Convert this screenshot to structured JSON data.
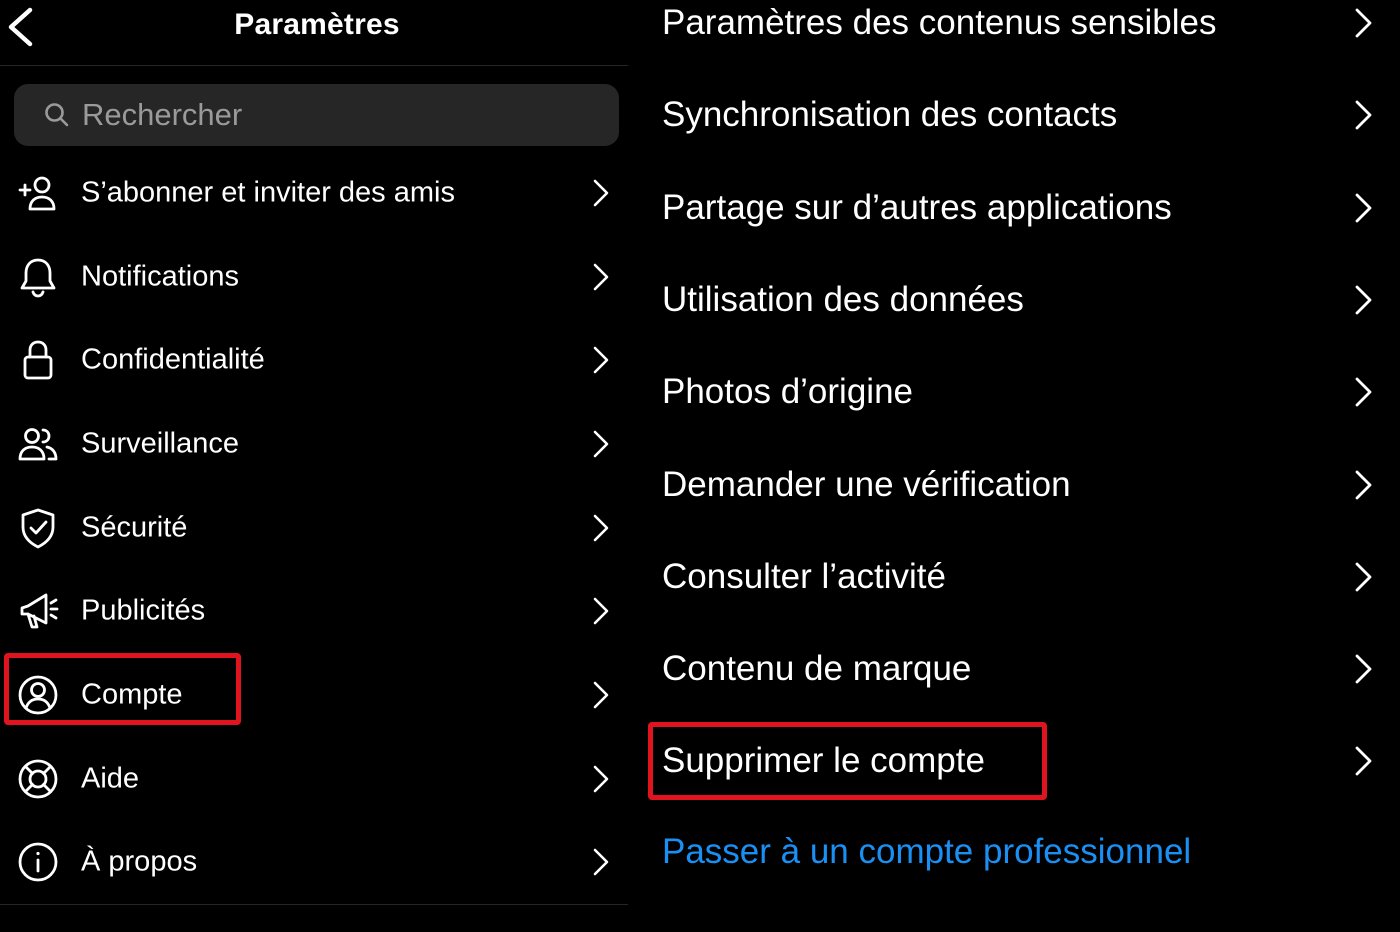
{
  "header": {
    "title": "Paramètres"
  },
  "search": {
    "placeholder": "Rechercher"
  },
  "left_menu": [
    {
      "label": "S’abonner et inviter des amis",
      "icon": "add-person-icon"
    },
    {
      "label": "Notifications",
      "icon": "bell-icon"
    },
    {
      "label": "Confidentialité",
      "icon": "lock-icon"
    },
    {
      "label": "Surveillance",
      "icon": "people-icon"
    },
    {
      "label": "Sécurité",
      "icon": "shield-check-icon"
    },
    {
      "label": "Publicités",
      "icon": "megaphone-icon"
    },
    {
      "label": "Compte",
      "icon": "account-circle-icon"
    },
    {
      "label": "Aide",
      "icon": "lifebuoy-icon"
    },
    {
      "label": "À propos",
      "icon": "info-icon"
    }
  ],
  "right_menu": [
    {
      "label": "Paramètres des contenus sensibles"
    },
    {
      "label": "Synchronisation des contacts"
    },
    {
      "label": "Partage sur d’autres applications"
    },
    {
      "label": "Utilisation des données"
    },
    {
      "label": "Photos d’origine"
    },
    {
      "label": "Demander une vérification"
    },
    {
      "label": "Consulter l’activité"
    },
    {
      "label": "Contenu de marque"
    },
    {
      "label": "Supprimer le compte"
    }
  ],
  "right_link": {
    "label": "Passer à un compte professionnel"
  },
  "colors": {
    "background": "#000000",
    "text": "#ffffff",
    "search_bg": "#262626",
    "link_blue": "#1a90f5",
    "highlight_red": "#e0141e"
  }
}
